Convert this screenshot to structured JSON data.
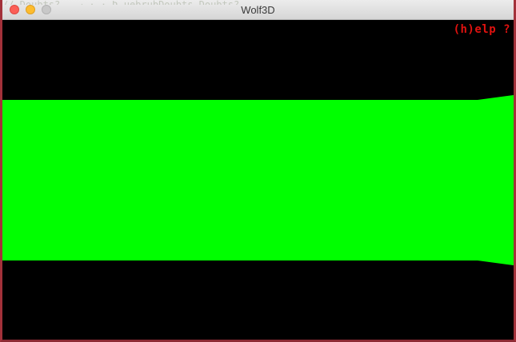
{
  "window": {
    "title": "Wolf3D"
  },
  "background_code_text": "// Doubts? —   →  ·  ·  Ʀ   uebrubDoubts Doubts?.",
  "hud": {
    "help_text": "(h)elp ?"
  },
  "colors": {
    "wall": "#00ff00",
    "ceiling": "#000000",
    "floor": "#000000",
    "hud_text": "#e0120f",
    "window_border": "#a3313a"
  }
}
